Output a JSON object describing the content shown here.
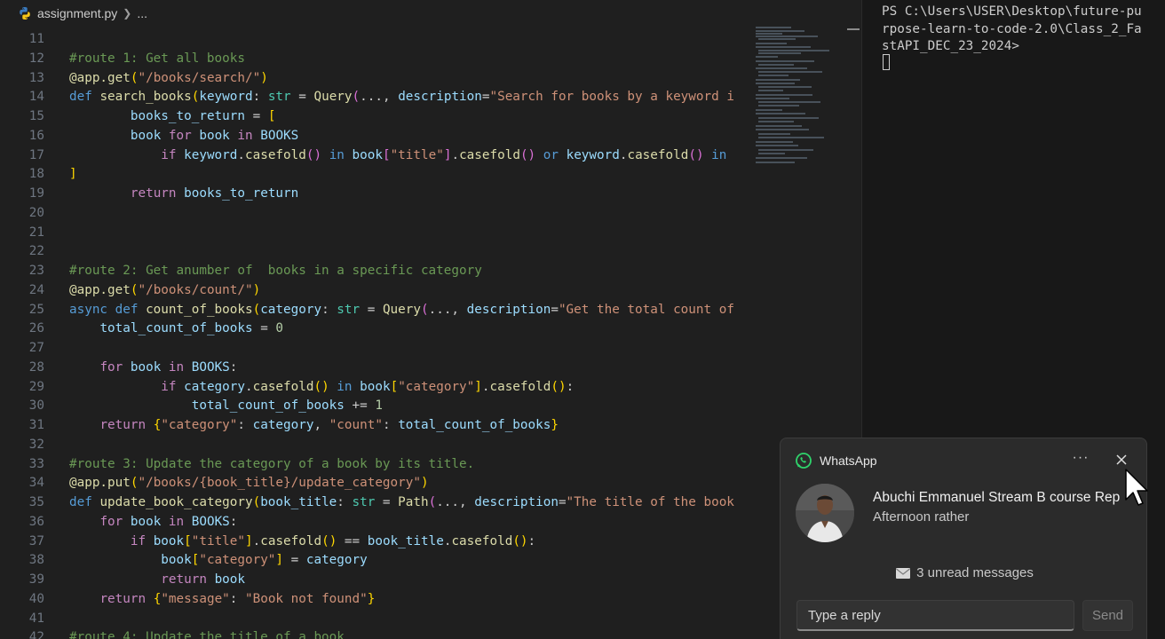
{
  "editor": {
    "breadcrumb": {
      "file": "assignment.py",
      "more": "..."
    },
    "lines": [
      {
        "n": "11",
        "t": []
      },
      {
        "n": "12",
        "t": [
          [
            "cm",
            "#route 1: Get all books"
          ]
        ]
      },
      {
        "n": "13",
        "t": [
          [
            "fn",
            "@app.get"
          ],
          [
            "br1",
            "("
          ],
          [
            "str",
            "\"/books/search/\""
          ],
          [
            "br1",
            ")"
          ]
        ]
      },
      {
        "n": "14",
        "t": [
          [
            "kw",
            "def "
          ],
          [
            "fn",
            "search_books"
          ],
          [
            "br1",
            "("
          ],
          [
            "var",
            "keyword"
          ],
          [
            "def",
            ": "
          ],
          [
            "cls",
            "str"
          ],
          [
            "def",
            " = "
          ],
          [
            "fn",
            "Query"
          ],
          [
            "br2",
            "("
          ],
          [
            "def",
            "..., "
          ],
          [
            "var",
            "description"
          ],
          [
            "def",
            "="
          ],
          [
            "str",
            "\"Search for books by a keyword i"
          ]
        ]
      },
      {
        "n": "15",
        "t": [
          [
            "def",
            "        "
          ],
          [
            "var",
            "books_to_return"
          ],
          [
            "def",
            " = "
          ],
          [
            "br1",
            "["
          ]
        ]
      },
      {
        "n": "16",
        "t": [
          [
            "def",
            "        "
          ],
          [
            "var",
            "book"
          ],
          [
            "ctl",
            " for "
          ],
          [
            "var",
            "book"
          ],
          [
            "ctl",
            " in "
          ],
          [
            "var",
            "BOOKS"
          ]
        ]
      },
      {
        "n": "17",
        "t": [
          [
            "def",
            "            "
          ],
          [
            "ctl",
            "if "
          ],
          [
            "var",
            "keyword"
          ],
          [
            "def",
            "."
          ],
          [
            "fn",
            "casefold"
          ],
          [
            "br2",
            "()"
          ],
          [
            "kw",
            " in "
          ],
          [
            "var",
            "book"
          ],
          [
            "br2",
            "["
          ],
          [
            "str",
            "\"title\""
          ],
          [
            "br2",
            "]"
          ],
          [
            "def",
            "."
          ],
          [
            "fn",
            "casefold"
          ],
          [
            "br2",
            "()"
          ],
          [
            "kw",
            " or "
          ],
          [
            "var",
            "keyword"
          ],
          [
            "def",
            "."
          ],
          [
            "fn",
            "casefold"
          ],
          [
            "br2",
            "()"
          ],
          [
            "kw",
            " in"
          ]
        ]
      },
      {
        "n": "18",
        "t": [
          [
            "br1",
            "]"
          ]
        ]
      },
      {
        "n": "19",
        "t": [
          [
            "def",
            "        "
          ],
          [
            "ctl",
            "return "
          ],
          [
            "var",
            "books_to_return"
          ]
        ]
      },
      {
        "n": "20",
        "t": []
      },
      {
        "n": "21",
        "t": []
      },
      {
        "n": "22",
        "t": []
      },
      {
        "n": "23",
        "t": [
          [
            "cm",
            "#route 2: Get anumber of  books in a specific category"
          ]
        ]
      },
      {
        "n": "24",
        "t": [
          [
            "fn",
            "@app.get"
          ],
          [
            "br1",
            "("
          ],
          [
            "str",
            "\"/books/count/\""
          ],
          [
            "br1",
            ")"
          ]
        ]
      },
      {
        "n": "25",
        "t": [
          [
            "kw",
            "async def "
          ],
          [
            "fn",
            "count_of_books"
          ],
          [
            "br1",
            "("
          ],
          [
            "var",
            "category"
          ],
          [
            "def",
            ": "
          ],
          [
            "cls",
            "str"
          ],
          [
            "def",
            " = "
          ],
          [
            "fn",
            "Query"
          ],
          [
            "br2",
            "("
          ],
          [
            "def",
            "..., "
          ],
          [
            "var",
            "description"
          ],
          [
            "def",
            "="
          ],
          [
            "str",
            "\"Get the total count of"
          ]
        ]
      },
      {
        "n": "26",
        "t": [
          [
            "def",
            "    "
          ],
          [
            "var",
            "total_count_of_books"
          ],
          [
            "def",
            " = "
          ],
          [
            "num",
            "0"
          ]
        ]
      },
      {
        "n": "27",
        "t": []
      },
      {
        "n": "28",
        "t": [
          [
            "def",
            "    "
          ],
          [
            "ctl",
            "for "
          ],
          [
            "var",
            "book"
          ],
          [
            "ctl",
            " in "
          ],
          [
            "var",
            "BOOKS"
          ],
          [
            "def",
            ":"
          ]
        ]
      },
      {
        "n": "29",
        "t": [
          [
            "def",
            "            "
          ],
          [
            "ctl",
            "if "
          ],
          [
            "var",
            "category"
          ],
          [
            "def",
            "."
          ],
          [
            "fn",
            "casefold"
          ],
          [
            "br1",
            "()"
          ],
          [
            "kw",
            " in "
          ],
          [
            "var",
            "book"
          ],
          [
            "br1",
            "["
          ],
          [
            "str",
            "\"category\""
          ],
          [
            "br1",
            "]"
          ],
          [
            "def",
            "."
          ],
          [
            "fn",
            "casefold"
          ],
          [
            "br1",
            "()"
          ],
          [
            "def",
            ":"
          ]
        ]
      },
      {
        "n": "30",
        "t": [
          [
            "def",
            "                "
          ],
          [
            "var",
            "total_count_of_books"
          ],
          [
            "def",
            " += "
          ],
          [
            "num",
            "1"
          ]
        ]
      },
      {
        "n": "31",
        "t": [
          [
            "def",
            "    "
          ],
          [
            "ctl",
            "return "
          ],
          [
            "br1",
            "{"
          ],
          [
            "str",
            "\"category\""
          ],
          [
            "def",
            ": "
          ],
          [
            "var",
            "category"
          ],
          [
            "def",
            ", "
          ],
          [
            "str",
            "\"count\""
          ],
          [
            "def",
            ": "
          ],
          [
            "var",
            "total_count_of_books"
          ],
          [
            "br1",
            "}"
          ]
        ]
      },
      {
        "n": "32",
        "t": []
      },
      {
        "n": "33",
        "t": [
          [
            "cm",
            "#route 3: Update the category of a book by its title."
          ]
        ]
      },
      {
        "n": "34",
        "t": [
          [
            "fn",
            "@app.put"
          ],
          [
            "br1",
            "("
          ],
          [
            "str",
            "\"/books/{book_title}/update_category\""
          ],
          [
            "br1",
            ")"
          ]
        ]
      },
      {
        "n": "35",
        "t": [
          [
            "kw",
            "def "
          ],
          [
            "fn",
            "update_book_category"
          ],
          [
            "br1",
            "("
          ],
          [
            "var",
            "book_title"
          ],
          [
            "def",
            ": "
          ],
          [
            "cls",
            "str"
          ],
          [
            "def",
            " = "
          ],
          [
            "fn",
            "Path"
          ],
          [
            "br2",
            "("
          ],
          [
            "def",
            "..., "
          ],
          [
            "var",
            "description"
          ],
          [
            "def",
            "="
          ],
          [
            "str",
            "\"The title of the book"
          ]
        ]
      },
      {
        "n": "36",
        "t": [
          [
            "def",
            "    "
          ],
          [
            "ctl",
            "for "
          ],
          [
            "var",
            "book"
          ],
          [
            "ctl",
            " in "
          ],
          [
            "var",
            "BOOKS"
          ],
          [
            "def",
            ":"
          ]
        ]
      },
      {
        "n": "37",
        "t": [
          [
            "def",
            "        "
          ],
          [
            "ctl",
            "if "
          ],
          [
            "var",
            "book"
          ],
          [
            "br1",
            "["
          ],
          [
            "str",
            "\"title\""
          ],
          [
            "br1",
            "]"
          ],
          [
            "def",
            "."
          ],
          [
            "fn",
            "casefold"
          ],
          [
            "br1",
            "()"
          ],
          [
            "def",
            " == "
          ],
          [
            "var",
            "book_title"
          ],
          [
            "def",
            "."
          ],
          [
            "fn",
            "casefold"
          ],
          [
            "br1",
            "()"
          ],
          [
            "def",
            ":"
          ]
        ]
      },
      {
        "n": "38",
        "t": [
          [
            "def",
            "            "
          ],
          [
            "var",
            "book"
          ],
          [
            "br1",
            "["
          ],
          [
            "str",
            "\"category\""
          ],
          [
            "br1",
            "]"
          ],
          [
            "def",
            " = "
          ],
          [
            "var",
            "category"
          ]
        ]
      },
      {
        "n": "39",
        "t": [
          [
            "def",
            "            "
          ],
          [
            "ctl",
            "return "
          ],
          [
            "var",
            "book"
          ]
        ]
      },
      {
        "n": "40",
        "t": [
          [
            "def",
            "    "
          ],
          [
            "ctl",
            "return "
          ],
          [
            "br1",
            "{"
          ],
          [
            "str",
            "\"message\""
          ],
          [
            "def",
            ": "
          ],
          [
            "str",
            "\"Book not found\""
          ],
          [
            "br1",
            "}"
          ]
        ]
      },
      {
        "n": "41",
        "t": []
      },
      {
        "n": "42",
        "t": [
          [
            "cm",
            "#route 4: Update the title of a book"
          ]
        ]
      }
    ]
  },
  "terminal": {
    "text": "PS C:\\Users\\USER\\Desktop\\future-purpose-learn-to-code-2.0\\Class_2_FastAPI_DEC_23_2024>"
  },
  "notification": {
    "app": "WhatsApp",
    "more": "···",
    "sender": "Abuchi Emmanuel Stream B course Rep",
    "message": "Afternoon rather",
    "unread": "3 unread messages",
    "reply_placeholder": "Type a reply",
    "send": "Send"
  }
}
